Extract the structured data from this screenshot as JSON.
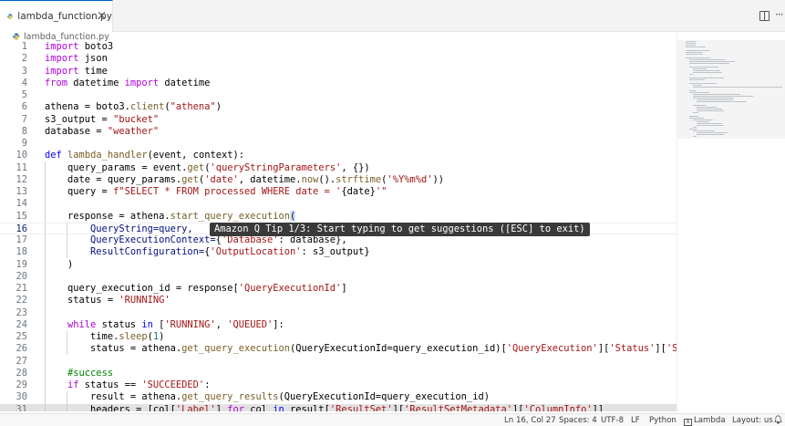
{
  "tab": {
    "label": "lambda_function.py",
    "close": "×"
  },
  "toolbar": {
    "more": "···"
  },
  "breadcrumb": {
    "file": "lambda_function.py"
  },
  "editor": {
    "active_line": 16,
    "lines": [
      {
        "n": "1"
      },
      {
        "n": "2"
      },
      {
        "n": "3"
      },
      {
        "n": "4"
      },
      {
        "n": "5"
      },
      {
        "n": "6"
      },
      {
        "n": "7"
      },
      {
        "n": "8"
      },
      {
        "n": "9"
      },
      {
        "n": "10"
      },
      {
        "n": "11"
      },
      {
        "n": "12"
      },
      {
        "n": "13"
      },
      {
        "n": "14"
      },
      {
        "n": "15"
      },
      {
        "n": "16"
      },
      {
        "n": "17"
      },
      {
        "n": "18"
      },
      {
        "n": "19"
      },
      {
        "n": "20"
      },
      {
        "n": "21"
      },
      {
        "n": "22"
      },
      {
        "n": "23"
      },
      {
        "n": "24"
      },
      {
        "n": "25"
      },
      {
        "n": "26"
      },
      {
        "n": "27"
      },
      {
        "n": "28"
      },
      {
        "n": "29"
      },
      {
        "n": "30"
      },
      {
        "n": "31"
      }
    ],
    "code": {
      "l1": [
        "import",
        " boto3"
      ],
      "l2": [
        "import",
        " json"
      ],
      "l3": [
        "import",
        " time"
      ],
      "l4": [
        "from",
        " datetime ",
        "import",
        " datetime"
      ],
      "l6": [
        "athena = boto3.",
        "client",
        "(",
        "\"athena\"",
        ")"
      ],
      "l7": [
        "s3_output = ",
        "\"bucket\""
      ],
      "l8": [
        "database = ",
        "\"weather\""
      ],
      "l10": [
        "def",
        " ",
        "lambda_handler",
        "(event, context):"
      ],
      "l11": [
        "    query_params = event.",
        "get",
        "(",
        "'queryStringParameters'",
        ", {})"
      ],
      "l12": [
        "    date = query_params.",
        "get",
        "(",
        "'date'",
        ", datetime.",
        "now",
        "().",
        "strftime",
        "(",
        "'%Y%m%d'",
        "))"
      ],
      "l13": [
        "    query = ",
        "f\"SELECT * FROM processed WHERE date = '",
        "{date}",
        "'\""
      ],
      "l15": [
        "    response = athena.",
        "start_query_execution",
        "("
      ],
      "l16": [
        "        QueryString=query,"
      ],
      "l17": [
        "        QueryExecutionContext=",
        "{",
        "'Database'",
        ": database},"
      ],
      "l18": [
        "        ResultConfiguration=",
        "{",
        "'OutputLocation'",
        ": s3_output}"
      ],
      "l19": [
        "    )"
      ],
      "l21": [
        "    query_execution_id = response[",
        "'QueryExecutionId'",
        "]"
      ],
      "l22": [
        "    status = ",
        "'RUNNING'"
      ],
      "l24": [
        "    ",
        "while",
        " status ",
        "in",
        " [",
        "'RUNNING'",
        ", ",
        "'QUEUED'",
        "]:"
      ],
      "l25": [
        "        time.",
        "sleep",
        "(",
        "1",
        ")"
      ],
      "l26": [
        "        status = athena.",
        "get_query_execution",
        "(QueryExecutionId=query_execution_id)[",
        "'QueryExecution'",
        "][",
        "'Status'",
        "][",
        "'State'",
        "]"
      ],
      "l28": [
        "    ",
        "#success"
      ],
      "l29": [
        "    ",
        "if",
        " status == ",
        "'SUCCEEDED'",
        ":"
      ],
      "l30": [
        "        result = athena.",
        "get_query_results",
        "(QueryExecutionId=query_execution_id)"
      ],
      "l31": [
        "        headers = [col[",
        "'Label'",
        "] ",
        "for",
        " col ",
        "in",
        " result[",
        "'ResultSet'",
        "][",
        "'ResultSetMetadata'",
        "][",
        "'ColumnInfo'",
        "]]"
      ]
    }
  },
  "tip": {
    "text": "Amazon Q Tip 1/3: Start typing to get suggestions ([ESC] to exit)"
  },
  "statusbar": {
    "position": "Ln 16, Col 27",
    "spaces": "Spaces: 4",
    "encoding": "UTF-8",
    "eol": "LF",
    "language": "Python",
    "lambda": "Lambda",
    "layout": "Layout: us"
  },
  "colors": {
    "keyword": "#af00db",
    "string": "#a31515",
    "function": "#795e26",
    "variable": "#001080",
    "accent": "#005fb8"
  }
}
